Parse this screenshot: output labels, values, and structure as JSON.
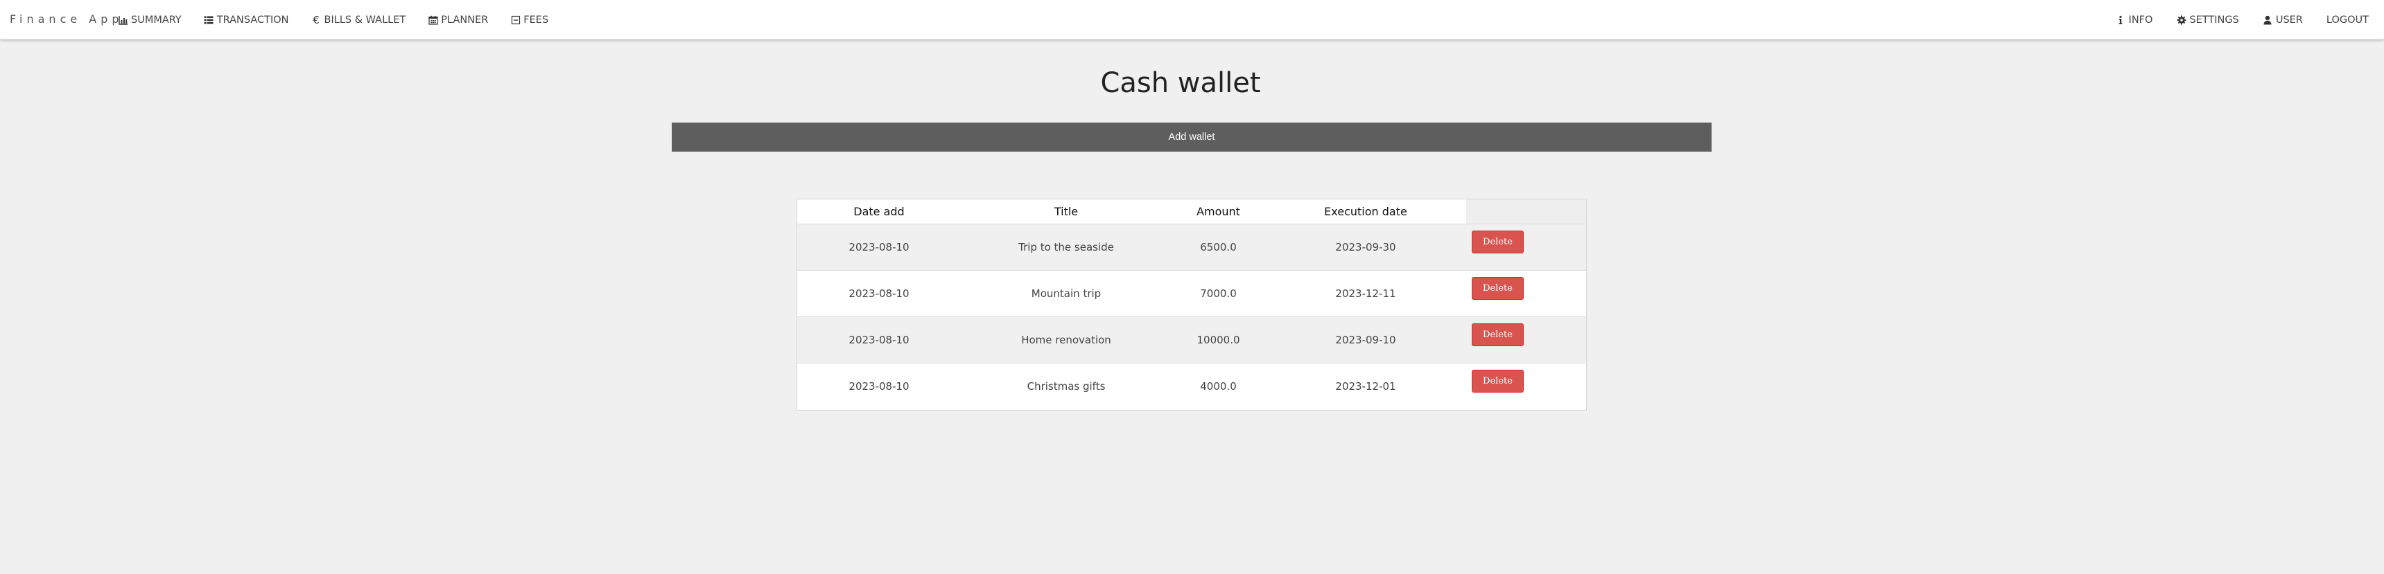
{
  "app": {
    "brand": "Finance App"
  },
  "nav": {
    "left": [
      {
        "label": "SUMMARY",
        "icon": "bar-chart-icon"
      },
      {
        "label": "TRANSACTION",
        "icon": "list-icon"
      },
      {
        "label": "BILLS & WALLET",
        "icon": "euro-icon"
      },
      {
        "label": "PLANNER",
        "icon": "calendar-icon"
      },
      {
        "label": "FEES",
        "icon": "minus-square-icon"
      }
    ],
    "right": [
      {
        "label": "INFO",
        "icon": "info-icon"
      },
      {
        "label": "SETTINGS",
        "icon": "gear-icon"
      },
      {
        "label": "USER",
        "icon": "user-icon"
      },
      {
        "label": "LOGOUT",
        "icon": ""
      }
    ]
  },
  "page": {
    "title": "Cash wallet",
    "add_wallet_label": "Add wallet"
  },
  "table": {
    "headers": [
      "Date add",
      "Title",
      "Amount",
      "Execution date",
      ""
    ],
    "rows": [
      {
        "date_add": "2023-08-10",
        "title": "Trip to the seaside",
        "amount": "6500.0",
        "execution_date": "2023-09-30",
        "action": "Delete"
      },
      {
        "date_add": "2023-08-10",
        "title": "Mountain trip",
        "amount": "7000.0",
        "execution_date": "2023-12-11",
        "action": "Delete"
      },
      {
        "date_add": "2023-08-10",
        "title": "Home renovation",
        "amount": "10000.0",
        "execution_date": "2023-09-10",
        "action": "Delete"
      },
      {
        "date_add": "2023-08-10",
        "title": "Christmas gifts",
        "amount": "4000.0",
        "execution_date": "2023-12-01",
        "action": "Delete"
      }
    ]
  },
  "colors": {
    "background": "#f0f0f0",
    "navbar": "#ffffff",
    "add_wallet_bar": "#5e5e5e",
    "delete_button": "#d9534f"
  }
}
